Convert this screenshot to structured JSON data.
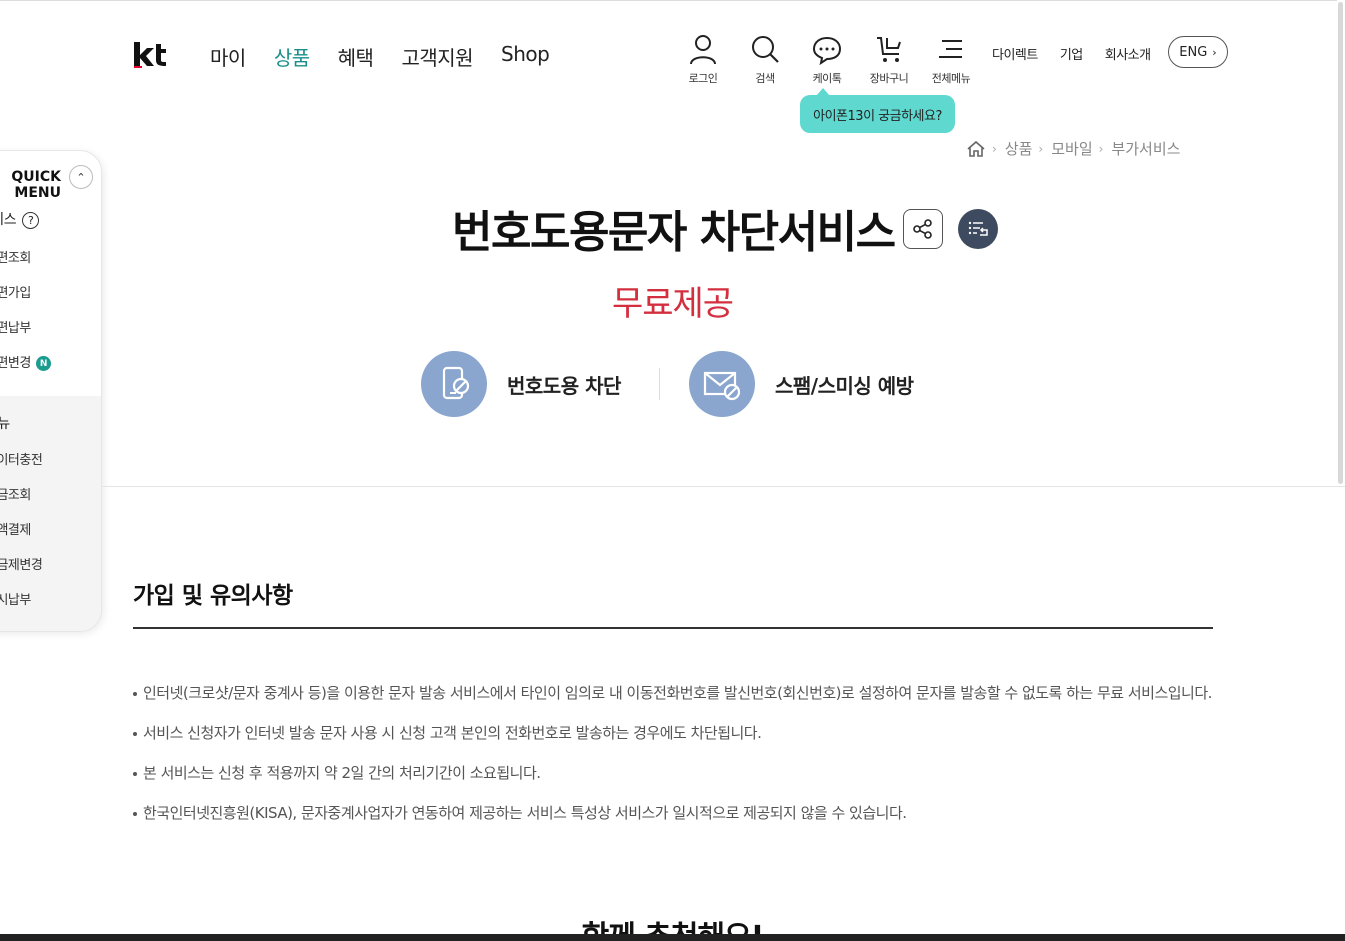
{
  "header": {
    "logo_text": "kt",
    "nav": [
      "마이",
      "상품",
      "혜택",
      "고객지원",
      "Shop"
    ],
    "nav_active_index": 1,
    "utility": [
      {
        "icon": "person-icon",
        "label": "로그인"
      },
      {
        "icon": "search-icon",
        "label": "검색"
      },
      {
        "icon": "chat-icon",
        "label": "케이톡"
      },
      {
        "icon": "cart-icon",
        "label": "장바구니"
      },
      {
        "icon": "menu-icon",
        "label": "전체메뉴"
      }
    ],
    "top_links": [
      "다이렉트",
      "기업",
      "회사소개"
    ],
    "lang_button": "ENG",
    "tooltip": "아이폰13이 궁금하세요?"
  },
  "breadcrumb": {
    "items": [
      "상품",
      "모바일",
      "부가서비스"
    ]
  },
  "quick_menu": {
    "title": "QUICK MENU",
    "items_top": [
      {
        "label": "서비스",
        "help": "?"
      },
      {
        "label": "간편조회"
      },
      {
        "label": "간편가입"
      },
      {
        "label": "간편납부"
      },
      {
        "label": "간편변경",
        "badge": "N"
      }
    ],
    "section_label": "메뉴",
    "items_bottom": [
      "데이터충전",
      "요금조회",
      "소액결제",
      "요금제변경",
      "즉시납부"
    ]
  },
  "product": {
    "title": "번호도용문자 차단서비스",
    "price": "무료제공",
    "features": [
      {
        "icon": "phone-block-icon",
        "label": "번호도용 차단"
      },
      {
        "icon": "mail-block-icon",
        "label": "스팸/스미싱 예방"
      }
    ]
  },
  "notices": {
    "title": "가입 및 유의사항",
    "items": [
      "인터넷(크로샷/문자 중계사 등)을 이용한 문자 발송 서비스에서 타인이 임의로 내 이동전화번호를 발신번호(회신번호)로 설정하여 문자를 발송할 수 없도록 하는 무료 서비스입니다.",
      "서비스 신청자가 인터넷 발송 문자 사용 시 신청 고객 본인의 전화번호로 발송하는 경우에도 차단됩니다.",
      "본 서비스는 신청 후 적용까지 약 2일 간의 처리기간이 소요됩니다.",
      "한국인터넷진흥원(KISA), 문자중계사업자가 연동하여 제공하는 서비스 특성상 서비스가 일시적으로 제공되지 않을 수 있습니다."
    ]
  },
  "bottom_heading": "함께 추천해요!",
  "colors": {
    "accent": "#1a8f8a",
    "price": "#d32f3f",
    "tooltip": "#5fd9d0",
    "feature_circle": "#8aa6cf"
  }
}
